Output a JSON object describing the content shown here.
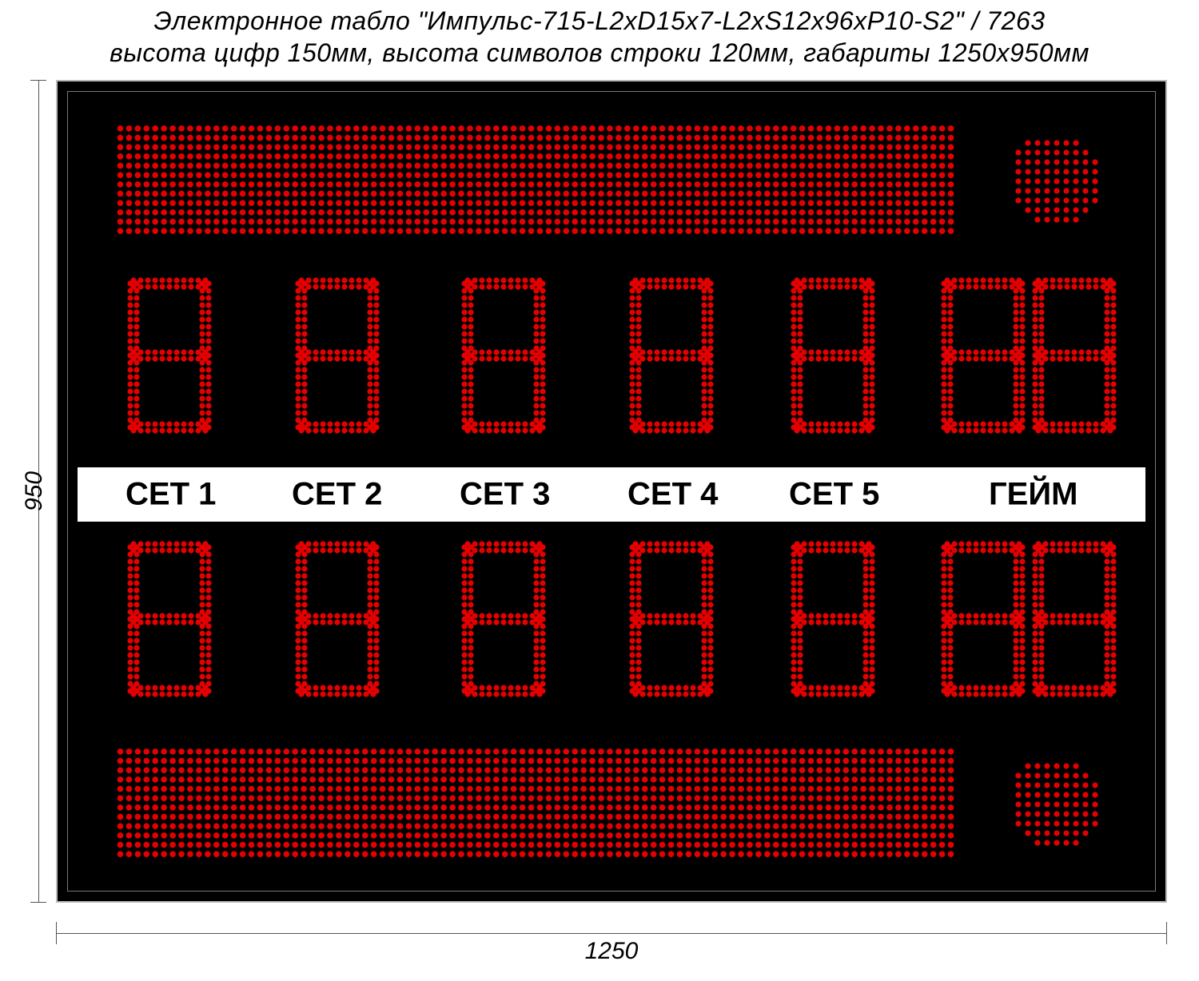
{
  "title": {
    "line1": "Электронное табло \"Импульс-715-L2xD15x7-L2xS12x96xP10-S2\" / 7263",
    "line2": "высота цифр 150мм, высота символов строки 120мм, габариты 1250х950мм"
  },
  "dimensions": {
    "width_label": "1250",
    "height_label": "950"
  },
  "labels": {
    "set1": "СЕТ 1",
    "set2": "СЕТ 2",
    "set3": "СЕТ 3",
    "set4": "СЕТ 4",
    "set5": "СЕТ 5",
    "game": "ГЕЙМ"
  },
  "scoreboard": {
    "top_text_line": "",
    "bottom_text_line": "",
    "player_top": {
      "set1": "8",
      "set2": "8",
      "set3": "8",
      "set4": "8",
      "set5": "8",
      "game": "88",
      "serve_indicator": true
    },
    "player_bottom": {
      "set1": "8",
      "set2": "8",
      "set3": "8",
      "set4": "8",
      "set5": "8",
      "game": "88",
      "serve_indicator": true
    }
  },
  "led_color": "#e40000"
}
